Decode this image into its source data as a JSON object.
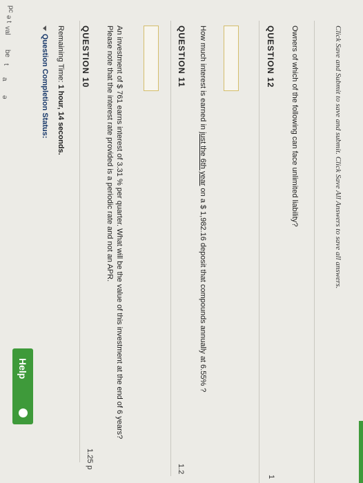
{
  "header": {
    "help_label": "Help",
    "remaining_prefix": "Remaining Time: ",
    "remaining_value": "1 hour, 14 seconds.",
    "status_label": "Question Completion Status:"
  },
  "edge_fragments": [
    "pc",
    "ə t",
    "val",
    "be",
    "t",
    "a",
    "ə"
  ],
  "questions": [
    {
      "title": "QUESTION 10",
      "points": "1.25 p",
      "text": "An investment of $ 761 earns interest of 3.31 % per quarter. What will be the value of this investment at the end of 6 years? Please note that the interest rate provided is a periodic rate and not an APR."
    },
    {
      "title": "QUESTION 11",
      "points": "1.2",
      "text_before": "How much interest is earned in ",
      "text_underline": "just the 6th year",
      "text_after": " on a $ 1,982.16 deposit that compounds annually at 6.55% ?"
    },
    {
      "title": "QUESTION 12",
      "points": "1",
      "text": "Owners of which of the following can face unlimited liability?"
    }
  ],
  "footer": {
    "text": "Click Save and Submit to save and submit. Click Save All Answers to save all answers."
  }
}
